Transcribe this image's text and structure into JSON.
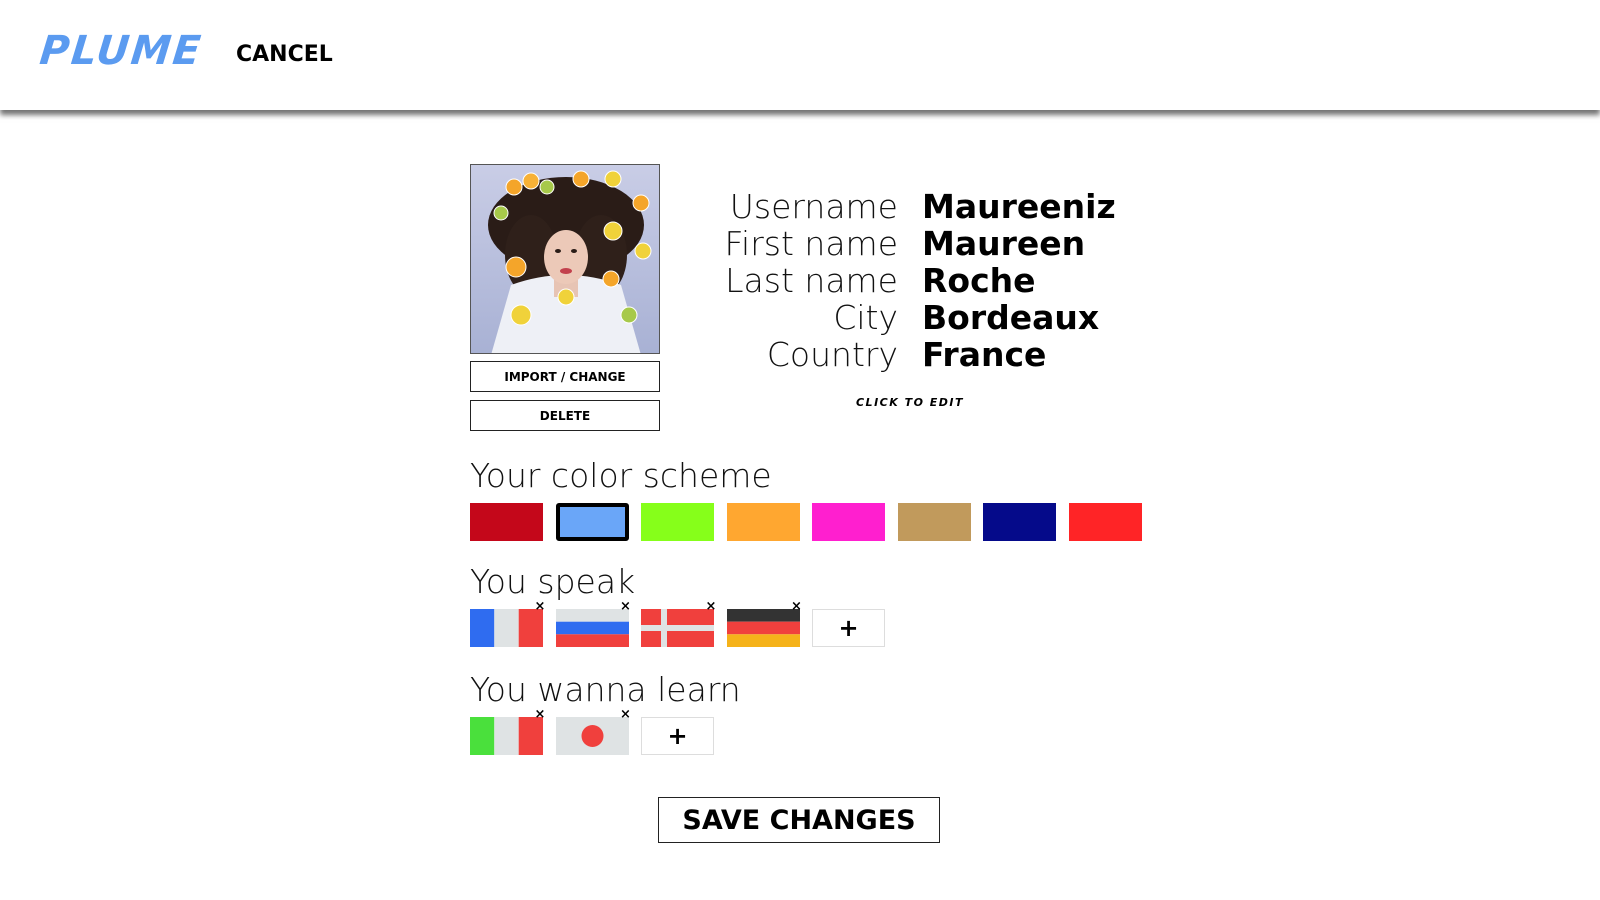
{
  "header": {
    "logo": "PLUME",
    "cancel_label": "CANCEL",
    "logo_color": "#5b9bf0"
  },
  "photo": {
    "import_label": "IMPORT / CHANGE",
    "delete_label": "DELETE"
  },
  "profile": {
    "fields": [
      {
        "label": "Username",
        "value": "Maureeniz"
      },
      {
        "label": "First name",
        "value": "Maureen"
      },
      {
        "label": "Last name",
        "value": "Roche"
      },
      {
        "label": "City",
        "value": "Bordeaux"
      },
      {
        "label": "Country",
        "value": "France"
      }
    ],
    "edit_hint": "CLICK TO EDIT"
  },
  "color_scheme": {
    "title": "Your color scheme",
    "colors": [
      "#c4071a",
      "#6aa6f8",
      "#86ff1a",
      "#ffa730",
      "#ff1fcf",
      "#c19a5c",
      "#050a8a",
      "#ff2426"
    ],
    "selected_index": 1
  },
  "speak": {
    "title": "You speak",
    "languages": [
      "france-flag-icon",
      "russia-flag-icon",
      "denmark-flag-icon",
      "germany-flag-icon"
    ],
    "remove_label": "×",
    "add_label": "+"
  },
  "learn": {
    "title": "You wanna learn",
    "languages": [
      "italy-flag-icon",
      "japan-flag-icon"
    ],
    "remove_label": "×",
    "add_label": "+"
  },
  "save_label": "SAVE CHANGES"
}
